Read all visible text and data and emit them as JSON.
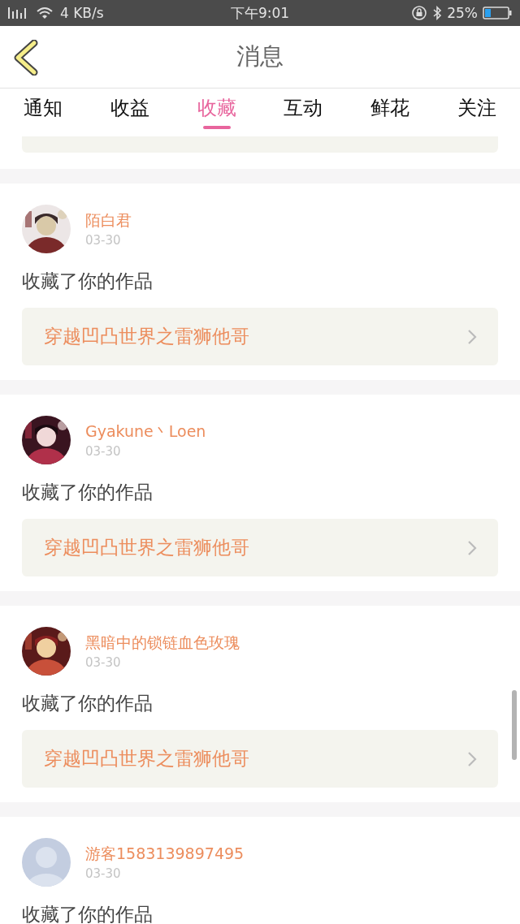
{
  "status_bar": {
    "speed": "4 KB/s",
    "time": "下午9:01",
    "battery": "25%"
  },
  "header": {
    "title": "消息"
  },
  "tabs": [
    {
      "label": "通知",
      "selected": false
    },
    {
      "label": "收益",
      "selected": false
    },
    {
      "label": "收藏",
      "selected": true
    },
    {
      "label": "互动",
      "selected": false
    },
    {
      "label": "鲜花",
      "selected": false
    },
    {
      "label": "关注",
      "selected": false
    }
  ],
  "messages": [
    {
      "kind": "partial"
    },
    {
      "kind": "full",
      "name": "陌白君",
      "date": "03-30",
      "action": "收藏了你的作品",
      "work": "穿越凹凸世界之雷狮他哥"
    },
    {
      "kind": "full",
      "name": "Gyakune丶Loen",
      "date": "03-30",
      "action": "收藏了你的作品",
      "work": "穿越凹凸世界之雷狮他哥"
    },
    {
      "kind": "full",
      "name": "黑暗中的锁链血色玫瑰",
      "date": "03-30",
      "action": "收藏了你的作品",
      "work": "穿越凹凸世界之雷狮他哥"
    },
    {
      "kind": "full",
      "avatar": {
        "kind": "default"
      },
      "name": "游客1583139897495",
      "date": "03-30",
      "action": "收藏了你的作品"
    }
  ]
}
